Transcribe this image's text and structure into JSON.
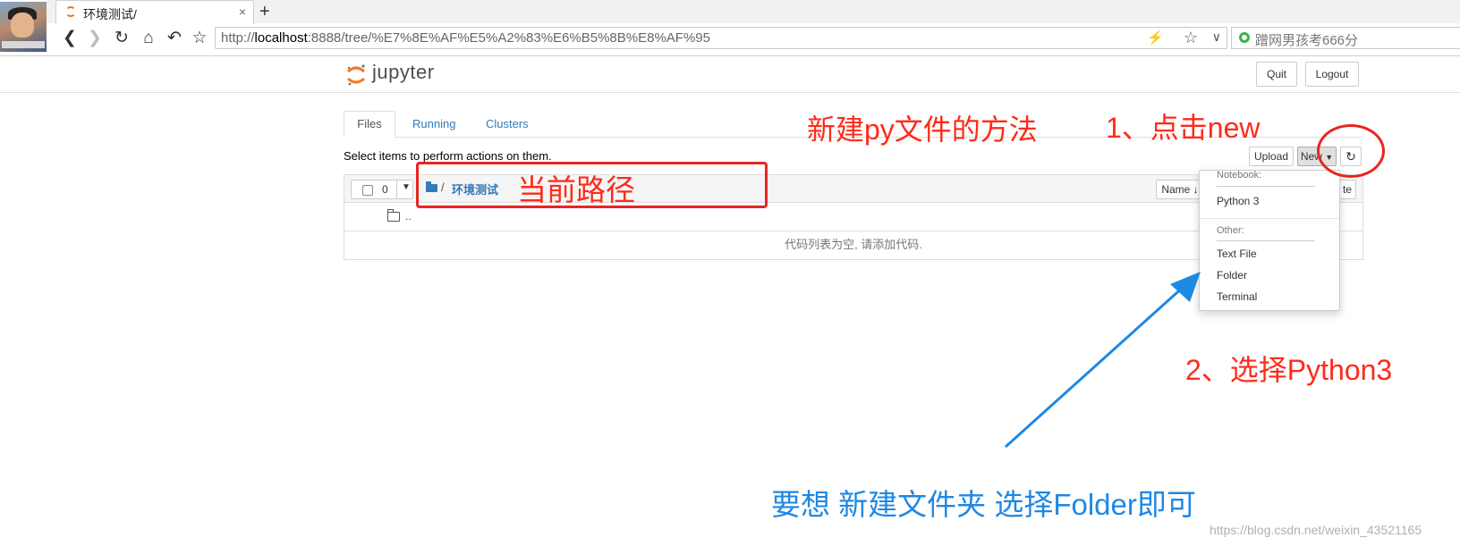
{
  "browser": {
    "tab_title": "环境测试/",
    "tab_close": "×",
    "new_tab": "+",
    "url_host_prefix": "http://",
    "url_host": "localhost",
    "url_rest": ":8888/tree/%E7%8E%AF%E5%A2%83%E6%B5%8B%E8%AF%95",
    "search_text": "蹭网男孩考666分"
  },
  "jupyter": {
    "logo_text": "jupyter",
    "quit_label": "Quit",
    "logout_label": "Logout",
    "tabs": [
      "Files",
      "Running",
      "Clusters"
    ],
    "hint": "Select items to perform actions on them.",
    "upload_label": "Upload",
    "new_label": "New",
    "selected_count": "0",
    "breadcrumb_slash": "/",
    "breadcrumb_folder": "环境测试",
    "sort_label": "Name",
    "delete_fragment": "te",
    "parent_dir": "..",
    "empty_message": "代码列表为空, 请添加代码."
  },
  "dropdown": {
    "notebook_header": "Notebook:",
    "python3": "Python 3",
    "other_header": "Other:",
    "text_file": "Text File",
    "folder": "Folder",
    "terminal": "Terminal"
  },
  "annotations": {
    "title_method": "新建py文件的方法",
    "step1": "1、点击new",
    "current_path": "当前路径",
    "step2": "2、选择Python3",
    "folder_hint": "要想 新建文件夹  选择Folder即可",
    "red": "#ff2a1a",
    "blue": "#1e88e5"
  },
  "watermark": "https://blog.csdn.net/weixin_43521165"
}
